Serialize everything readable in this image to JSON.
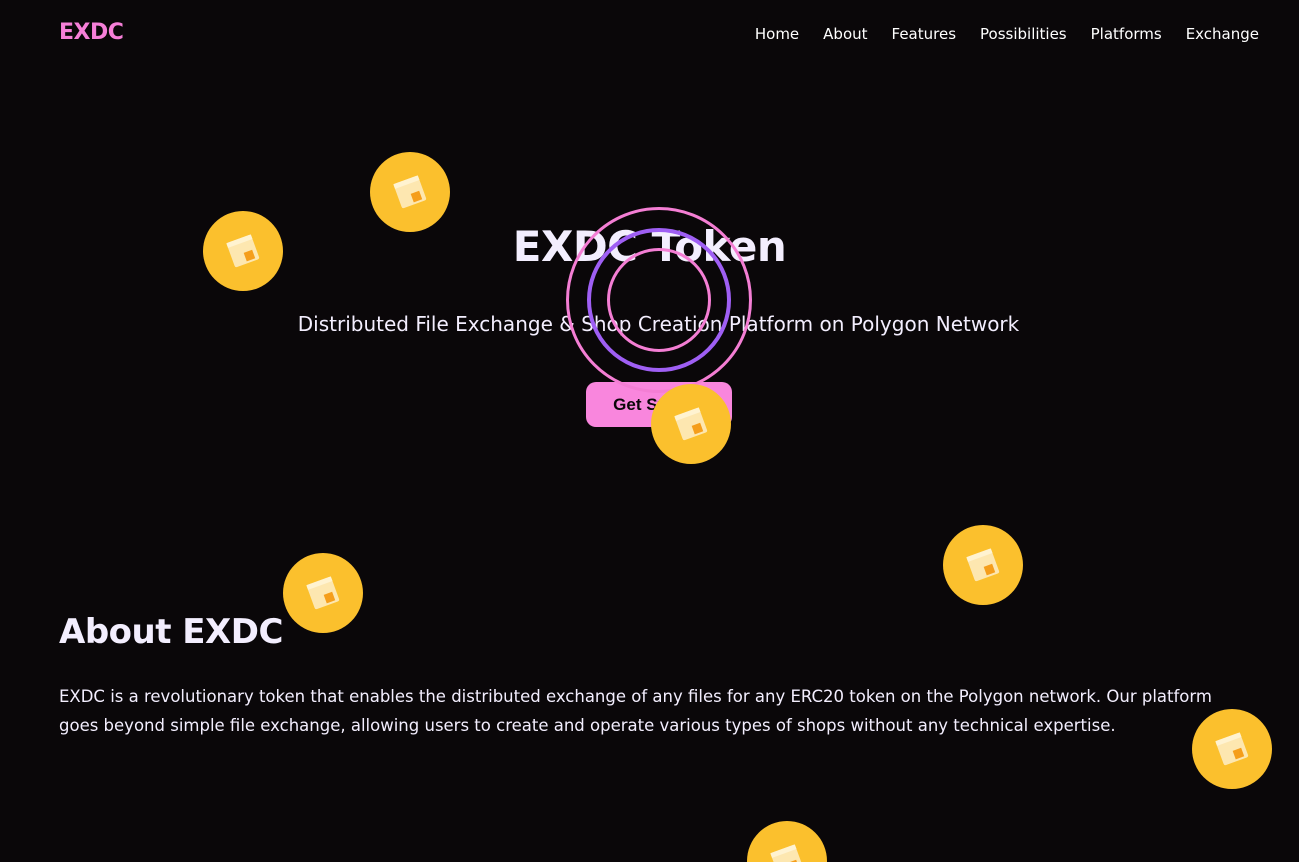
{
  "brand": {
    "logo": "EXDC",
    "accent": "#f67fd8",
    "coin_color": "#fbc02d",
    "ring_color_2": "#9f5ff4"
  },
  "nav": {
    "items": [
      "Home",
      "About",
      "Features",
      "Possibilities",
      "Platforms",
      "Exchange"
    ]
  },
  "hero": {
    "title": "EXDC Token",
    "subtitle": "Distributed File Exchange & Shop Creation Platform on Polygon Network",
    "cta_label": "Get Started"
  },
  "about": {
    "title": "About EXDC",
    "text": "EXDC is a revolutionary token that enables the distributed exchange of any files for any ERC20 token on the Polygon network. Our platform goes beyond simple file exchange, allowing users to create and operate various types of shops without any technical expertise."
  },
  "decor": {
    "coin_icon": "coin-icon"
  }
}
